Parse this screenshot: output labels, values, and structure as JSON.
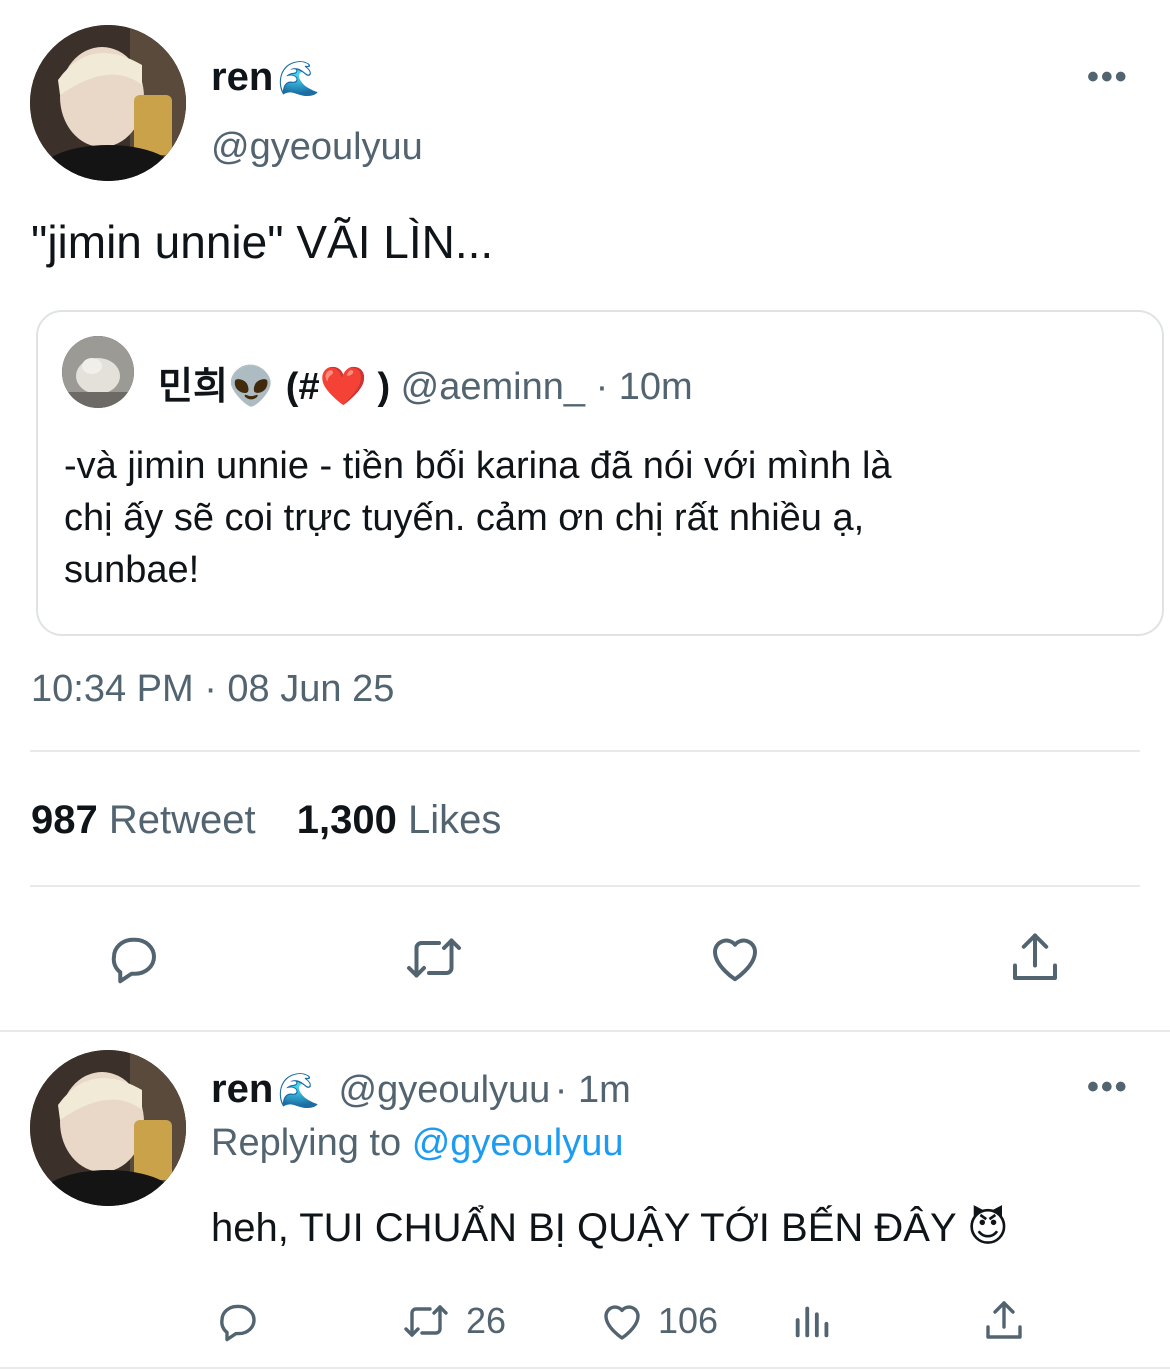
{
  "main_tweet": {
    "display_name": "ren",
    "name_emoji": "🌊",
    "handle": "@gyeoulyuu",
    "text": "\"jimin unnie\" VÃI LÌN...",
    "timestamp": "10:34 PM · 08 Jun 25",
    "retweet_count": "987",
    "retweet_label": "Retweet",
    "likes_count": "1,300",
    "likes_label": "Likes"
  },
  "quoted_tweet": {
    "display_name": "민희👽 (#❤️ )",
    "handle": "@aeminn_",
    "time": "· 10m",
    "text_line1": "-và jimin unnie - tiền bối karina đã nói với mình là",
    "text_line2": "chị ấy sẽ coi trực tuyến. cảm ơn chị rất nhiều ạ,",
    "text_line3": "sunbae!"
  },
  "reply_tweet": {
    "display_name": "ren",
    "name_emoji": "🌊",
    "handle": "@gyeoulyuu",
    "time": "· 1m",
    "replying_prefix": "Replying to",
    "replying_handle": "@gyeoulyuu",
    "text": "heh, TUI CHUẨN BỊ QUẬY TỚI BẾN ĐÂY 😈",
    "retweet_count": "26",
    "like_count": "106"
  },
  "more_glyph": "•••",
  "colors": {
    "text": "#0f1419",
    "secondary": "#536471",
    "link": "#1d9bf0",
    "divider": "#e7e9ea"
  },
  "icons": [
    "reply-icon",
    "retweet-icon",
    "like-icon",
    "share-icon",
    "analytics-icon",
    "more-icon"
  ]
}
